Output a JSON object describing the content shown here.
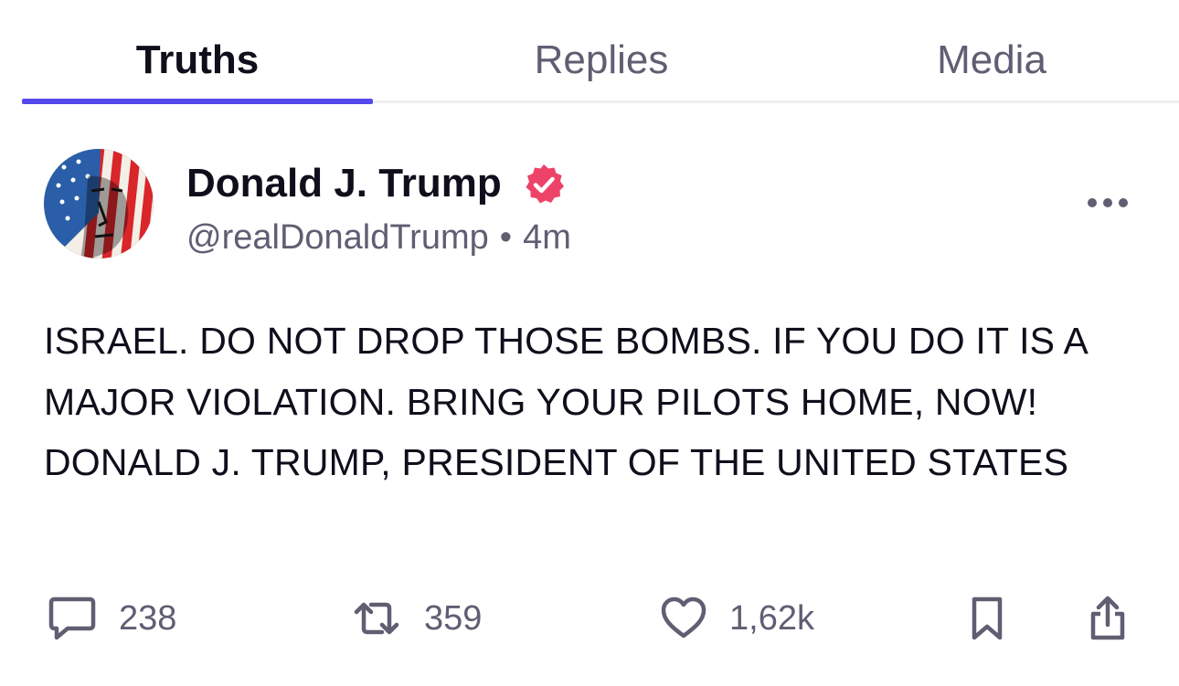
{
  "tabs": [
    {
      "label": "Truths",
      "active": true
    },
    {
      "label": "Replies",
      "active": false
    },
    {
      "label": "Media",
      "active": false
    }
  ],
  "post": {
    "author": {
      "display_name": "Donald J. Trump",
      "handle": "@realDonaldTrump",
      "verified": true
    },
    "separator": "•",
    "time": "4m",
    "text": "ISRAEL. DO NOT DROP THOSE BOMBS. IF YOU DO IT IS A MAJOR VIOLATION. BRING YOUR PILOTS HOME, NOW! DONALD J. TRUMP, PRESIDENT OF THE UNITED STATES",
    "actions": {
      "replies": "238",
      "retruths": "359",
      "likes": "1,62k"
    }
  },
  "icons": {
    "more": "more-horizontal-icon",
    "reply": "comment-bubble-icon",
    "retruth": "repost-arrows-icon",
    "like": "heart-icon",
    "bookmark": "bookmark-icon",
    "share": "share-icon",
    "verified": "verified-check-icon"
  },
  "colors": {
    "accent": "#5448ee",
    "verified": "#ee4368",
    "text": "#0f0f1c",
    "muted": "#5f5e72"
  }
}
